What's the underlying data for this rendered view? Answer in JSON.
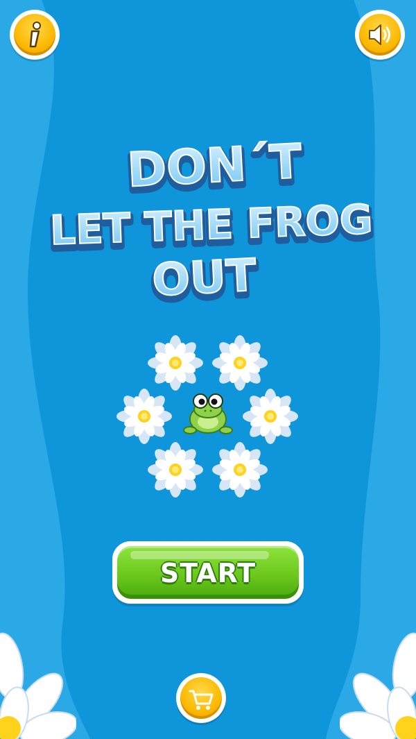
{
  "game": {
    "title_line1": "DON´T",
    "title_line2": "LET THE FROG",
    "title_line3": "OUT",
    "start_label": "START"
  },
  "buttons": {
    "info_icon": "info-icon",
    "sound_icon": "speaker-icon",
    "shop_icon": "cart-icon"
  },
  "colors": {
    "water_light": "#2aa9e6",
    "water_dark": "#0f8fd6",
    "accent_yellow": "#fbb800",
    "start_green": "#6cc81d",
    "title_blue": "#8ed6ff"
  }
}
